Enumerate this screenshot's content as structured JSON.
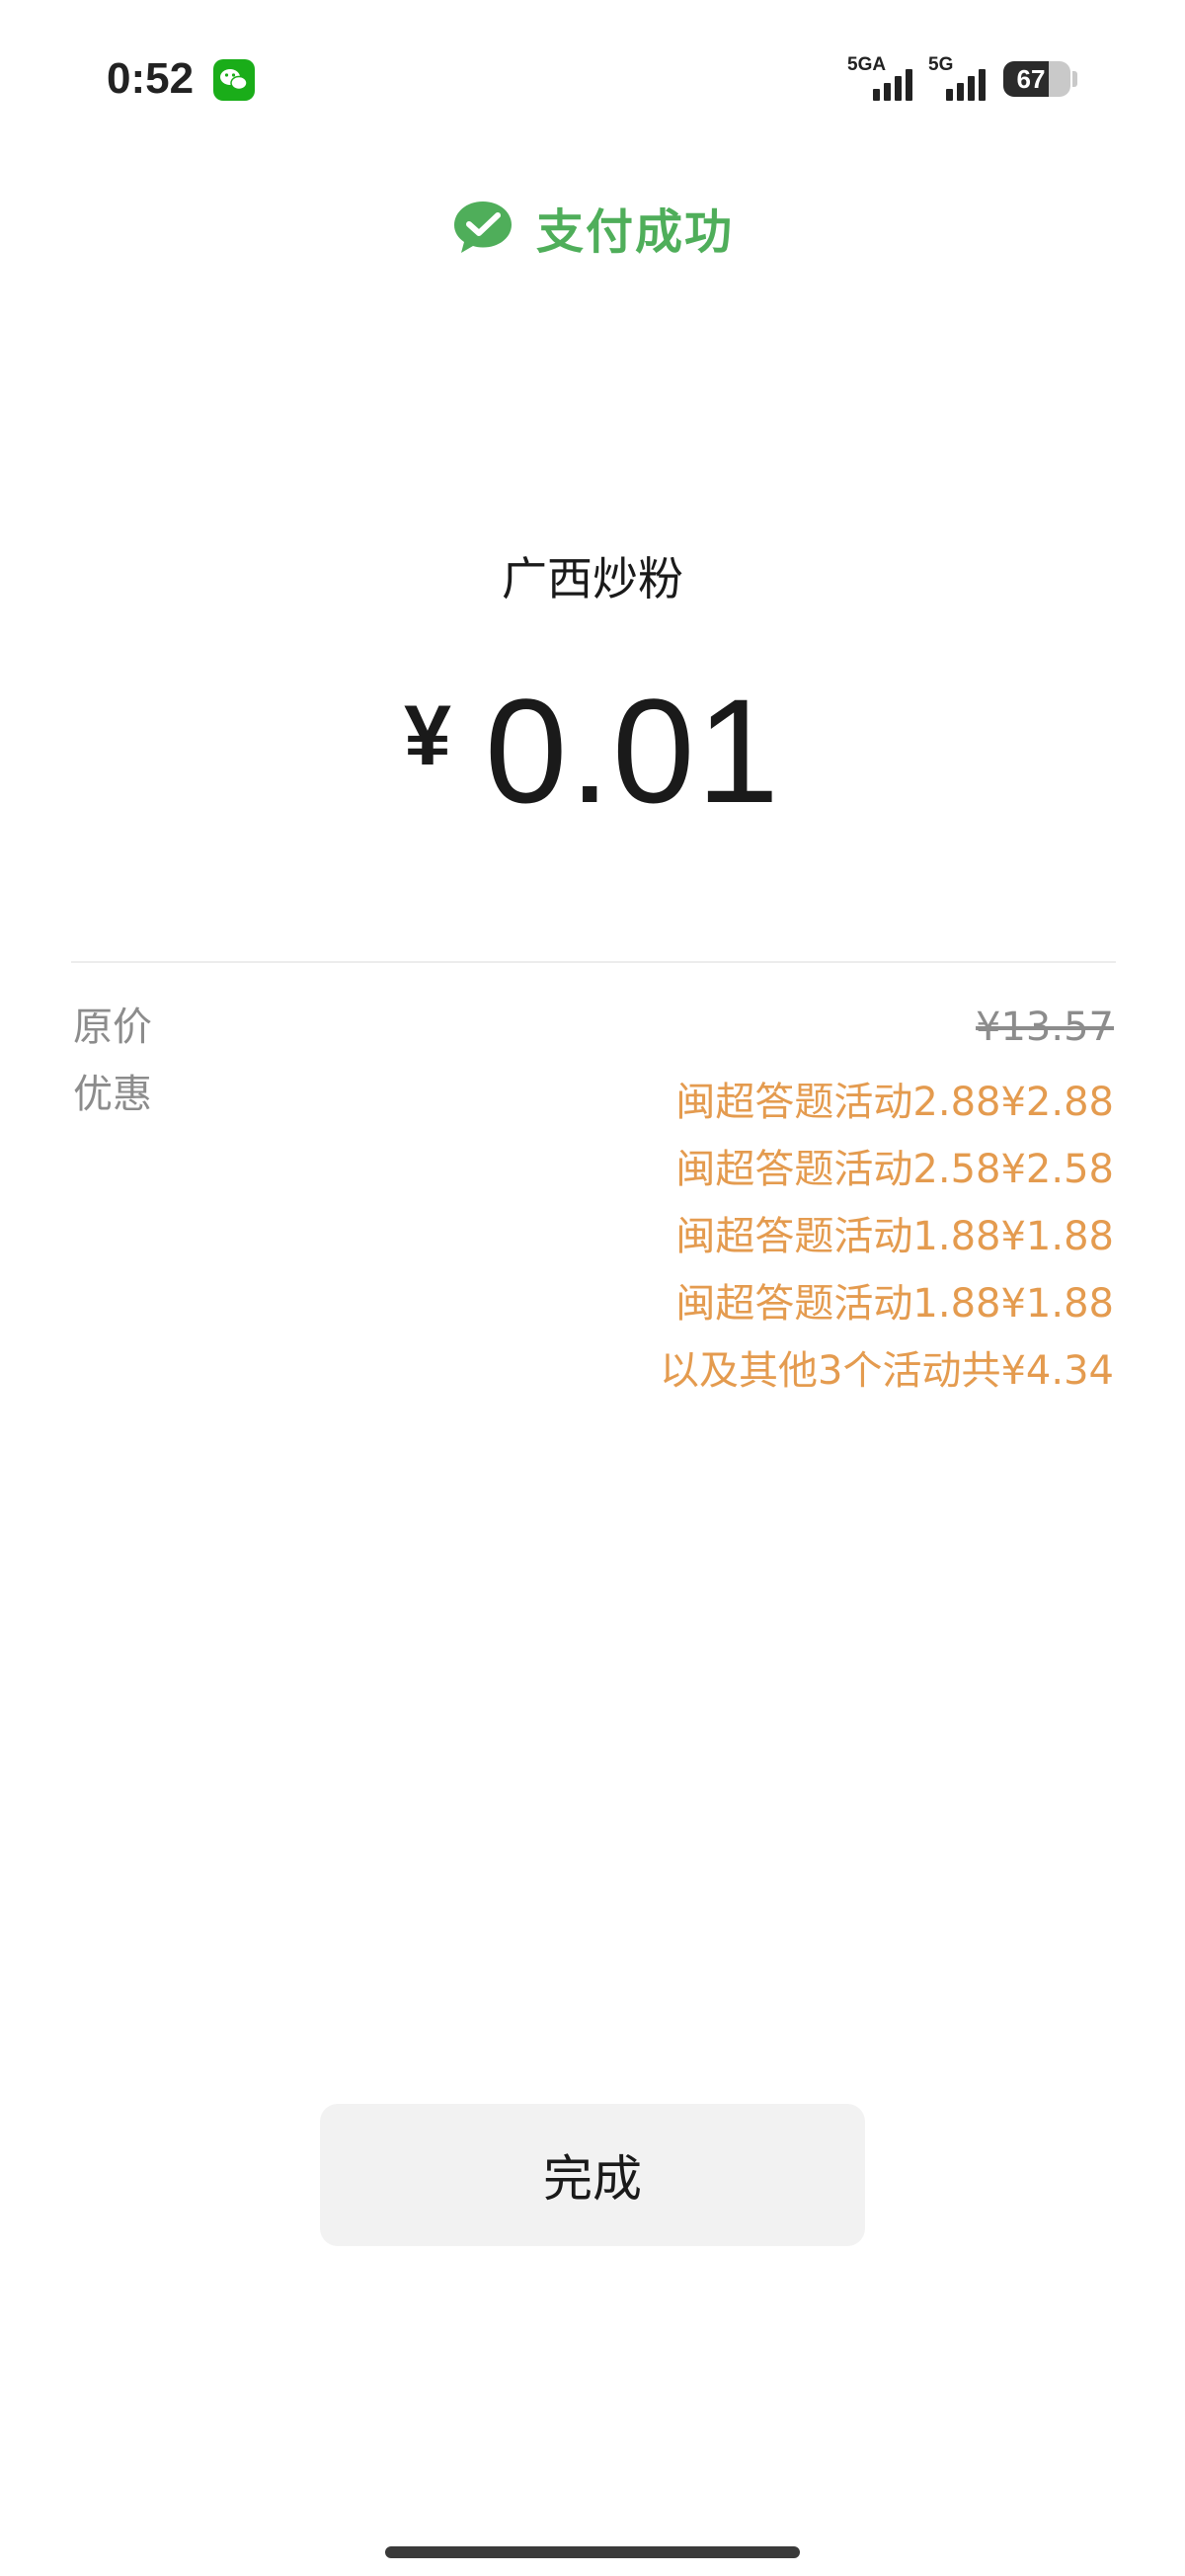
{
  "status_bar": {
    "time": "0:52",
    "notification_icon": "wechat-icon",
    "sim1_network": "5GA",
    "sim2_network": "5G",
    "battery_level": "67",
    "battery_fraction": 0.67
  },
  "header": {
    "icon": "wechat-pay-check-icon",
    "title": "支付成功",
    "title_color": "#4fae5a"
  },
  "payment": {
    "merchant": "广西炒粉",
    "currency": "¥",
    "amount": "0.01"
  },
  "details": {
    "original_price_label": "原价",
    "original_price": "¥13.57",
    "discount_label": "优惠",
    "discounts": [
      "闽超答题活动2.88¥2.88",
      "闽超答题活动2.58¥2.58",
      "闽超答题活动1.88¥1.88",
      "闽超答题活动1.88¥1.88",
      "以及其他3个活动共¥4.34"
    ],
    "discount_color": "#e49b4f"
  },
  "actions": {
    "done_label": "完成"
  }
}
